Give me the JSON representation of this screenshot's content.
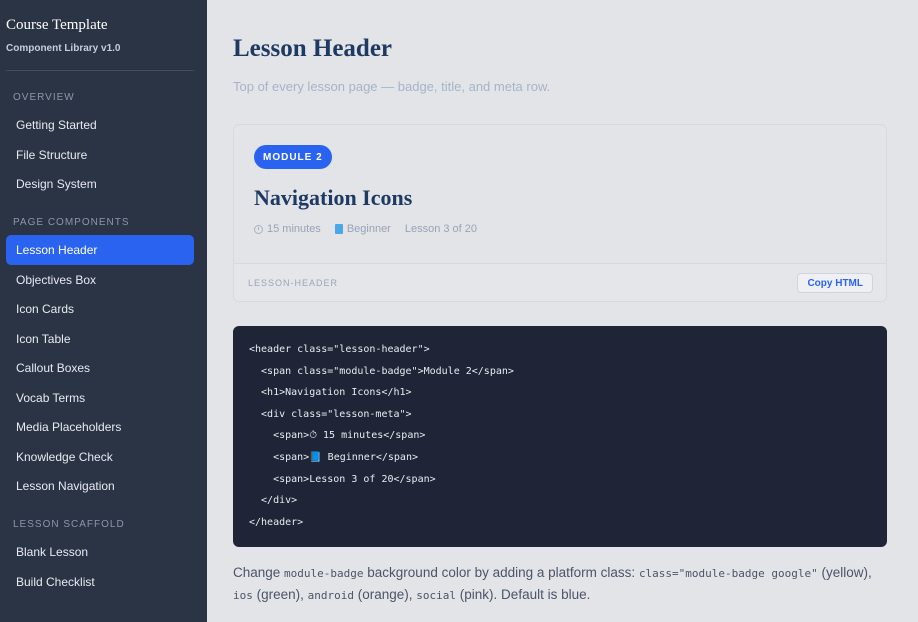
{
  "sidebar": {
    "title": "Course Template",
    "subtitle": "Component Library v1.0",
    "sections": [
      {
        "heading": "OVERVIEW",
        "items": [
          "Getting Started",
          "File Structure",
          "Design System"
        ]
      },
      {
        "heading": "PAGE COMPONENTS",
        "items": [
          "Lesson Header",
          "Objectives Box",
          "Icon Cards",
          "Icon Table",
          "Callout Boxes",
          "Vocab Terms",
          "Media Placeholders",
          "Knowledge Check",
          "Lesson Navigation"
        ]
      },
      {
        "heading": "LESSON SCAFFOLD",
        "items": [
          "Blank Lesson",
          "Build Checklist"
        ]
      }
    ],
    "active_item": "Lesson Header"
  },
  "main": {
    "title": "Lesson Header",
    "subtitle": "Top of every lesson page — badge, title, and meta row.",
    "preview": {
      "badge": "MODULE 2",
      "lesson_title": "Navigation Icons",
      "meta": {
        "duration": "15 minutes",
        "level": "Beginner",
        "progress": "Lesson 3 of 20"
      },
      "footer_label": "LESSON-HEADER",
      "copy_button": "Copy HTML"
    },
    "code_lines": [
      "<header class=\"lesson-header\">",
      "  <span class=\"module-badge\">Module 2</span>",
      "  <h1>Navigation Icons</h1>",
      "  <div class=\"lesson-meta\">",
      "    <span>⏱ 15 minutes</span>",
      "    <span>📘 Beginner</span>",
      "    <span>Lesson 3 of 20</span>",
      "  </div>",
      "</header>"
    ],
    "note": {
      "t1": "Change ",
      "c1": "module-badge",
      "t2": " background color by adding a platform class: ",
      "c2": "class=\"module-badge google\"",
      "t3": " (yellow), ",
      "c3": "ios",
      "t4": " (green), ",
      "c4": "android",
      "t5": " (orange), ",
      "c5": "social",
      "t6": " (pink). Default is blue."
    }
  },
  "colors": {
    "accent": "#2b63f1",
    "sidebar_bg": "#2a3445",
    "code_bg": "#1f2536",
    "heading": "#1f3a62"
  },
  "icons": {
    "duration": "clock-icon",
    "level": "book-icon"
  }
}
